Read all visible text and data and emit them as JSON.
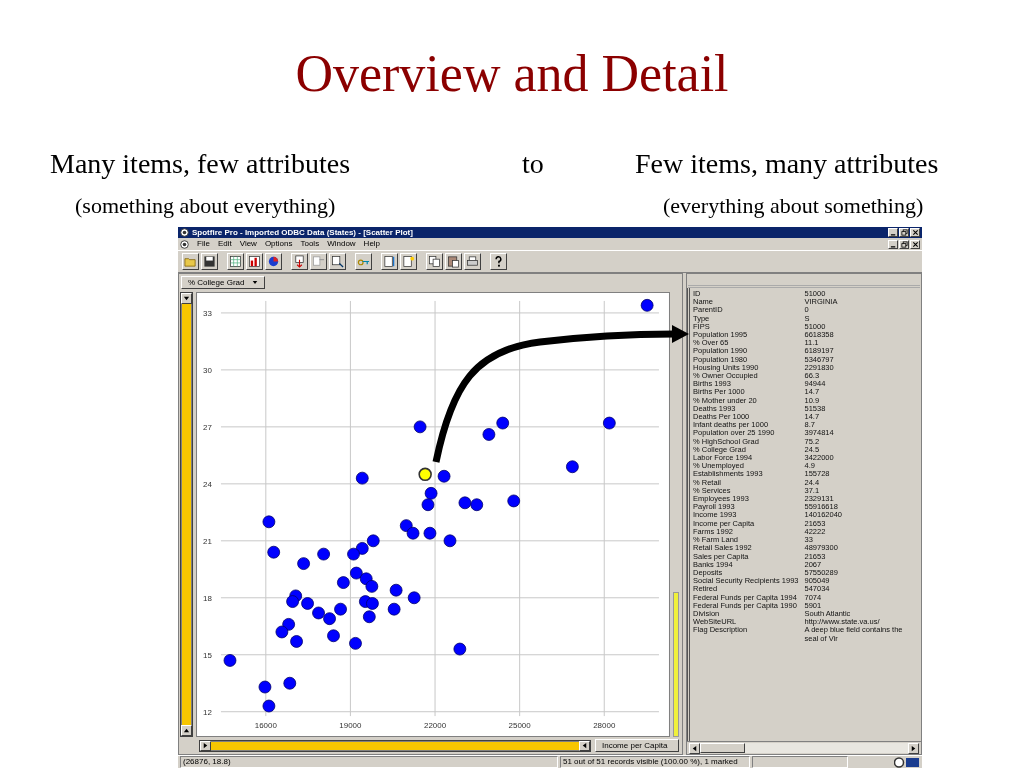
{
  "slide": {
    "title": "Overview and Detail",
    "left_heading": "Many items, few attributes",
    "connector": "to",
    "right_heading": "Few items, many attributes",
    "left_note": "(something about everything)",
    "right_note": "(everything about something)"
  },
  "window": {
    "title": "Spotfire Pro - Imported ODBC Data (States) - [Scatter Plot]"
  },
  "menu": [
    "File",
    "Edit",
    "View",
    "Options",
    "Tools",
    "Window",
    "Help"
  ],
  "scatter": {
    "y_axis_selector": "% College Grad",
    "x_axis_selector": "Income per Capita",
    "chart_data": {
      "type": "scatter",
      "grid": true,
      "xlim": [
        14410,
        29940
      ],
      "ylim": [
        11.77,
        33.63
      ],
      "xticks": [
        16000,
        19000,
        22000,
        25000,
        28000
      ],
      "yticks": [
        12,
        15,
        18,
        21,
        24,
        27,
        30,
        33
      ],
      "x": [
        29520,
        28180,
        26870,
        24400,
        23910,
        21470,
        21650,
        22320,
        19420,
        21860,
        21750,
        23060,
        23480,
        24790,
        16110,
        20980,
        21220,
        21820,
        22530,
        19810,
        19420,
        19110,
        16280,
        18050,
        17340,
        19210,
        18750,
        19560,
        19760,
        20620,
        21260,
        17060,
        16950,
        17480,
        19530,
        19780,
        18650,
        20550,
        17870,
        18260,
        19670,
        16810,
        16570,
        17090,
        18400,
        19180,
        22880,
        14730,
        16850,
        15970,
        16110
      ],
      "series": [
        {
          "color": "#0000ff",
          "values": [
            33.4,
            27.2,
            24.9,
            27.2,
            26.6,
            27.0,
            null,
            24.4,
            24.3,
            23.5,
            22.9,
            23.0,
            22.9,
            23.1,
            22.0,
            21.8,
            21.4,
            21.4,
            21.0,
            21.0,
            20.6,
            20.3,
            20.4,
            20.3,
            19.8,
            19.3,
            18.8,
            19.0,
            18.6,
            18.4,
            18.0,
            18.1,
            17.8,
            17.7,
            17.8,
            17.7,
            17.4,
            17.4,
            17.2,
            16.9,
            17.0,
            16.6,
            16.2,
            15.7,
            16.0,
            15.6,
            15.3,
            14.7,
            13.5,
            13.3,
            12.3
          ]
        },
        {
          "color": "#ffff00",
          "values": [
            null,
            null,
            null,
            null,
            null,
            null,
            24.5,
            null,
            null,
            null,
            null,
            null,
            null,
            null,
            null,
            null,
            null,
            null,
            null,
            null,
            null,
            null,
            null,
            null,
            null,
            null,
            null,
            null,
            null,
            null,
            null,
            null,
            null,
            null,
            null,
            null,
            null,
            null,
            null,
            null,
            null,
            null,
            null,
            null,
            null,
            null,
            null,
            null,
            null,
            null,
            null
          ]
        }
      ]
    }
  },
  "details": {
    "rows": [
      {
        "label": "ID",
        "value": "51000"
      },
      {
        "label": "Name",
        "value": "VIRGINIA"
      },
      {
        "label": "ParentID",
        "value": "0"
      },
      {
        "label": "Type",
        "value": "S"
      },
      {
        "label": "FIPS",
        "value": "51000"
      },
      {
        "label": "Population 1995",
        "value": "6618358"
      },
      {
        "label": "% Over 65",
        "value": "11.1"
      },
      {
        "label": "Population 1990",
        "value": "6189197"
      },
      {
        "label": "Population 1980",
        "value": "5346797"
      },
      {
        "label": "Housing Units 1990",
        "value": "2291830"
      },
      {
        "label": "% Owner Occupied",
        "value": "66.3"
      },
      {
        "label": "Births 1993",
        "value": "94944"
      },
      {
        "label": "Births Per 1000",
        "value": "14.7"
      },
      {
        "label": "% Mother under 20",
        "value": "10.9"
      },
      {
        "label": "Deaths 1993",
        "value": "51538"
      },
      {
        "label": "Deaths Per 1000",
        "value": "14.7"
      },
      {
        "label": "Infant deaths per 1000",
        "value": "8.7"
      },
      {
        "label": "Population over 25 1990",
        "value": "3974814"
      },
      {
        "label": "% HighSchool Grad",
        "value": "75.2"
      },
      {
        "label": "% College Grad",
        "value": "24.5"
      },
      {
        "label": "Labor Force 1994",
        "value": "3422000"
      },
      {
        "label": "% Unemployed",
        "value": "4.9"
      },
      {
        "label": "Establishments 1993",
        "value": "155728"
      },
      {
        "label": "% Retail",
        "value": "24.4"
      },
      {
        "label": "% Services",
        "value": "37.1"
      },
      {
        "label": "Employees 1993",
        "value": "2329131"
      },
      {
        "label": "Payroll 1993",
        "value": "55916618"
      },
      {
        "label": "Income 1993",
        "value": "140162040"
      },
      {
        "label": "Income per Capita",
        "value": "21653"
      },
      {
        "label": "Farms 1992",
        "value": "42222"
      },
      {
        "label": "% Farm Land",
        "value": "33"
      },
      {
        "label": "Retail Sales 1992",
        "value": "48979300"
      },
      {
        "label": "Sales per Capita",
        "value": "21653"
      },
      {
        "label": "Banks 1994",
        "value": "2067"
      },
      {
        "label": "Deposits",
        "value": "57550289"
      },
      {
        "label": "Social Security Recipients 1993",
        "value": "905049"
      },
      {
        "label": "Retired",
        "value": "547034"
      },
      {
        "label": "Federal Funds per Capita 1994",
        "value": "7074"
      },
      {
        "label": "Federal Funds per Capita 1990",
        "value": "5901"
      },
      {
        "label": "Division",
        "value": "South Atlantic"
      },
      {
        "label": "WebSiteURL",
        "value": "http://www.state.va.us/"
      },
      {
        "label": "Flag Description",
        "value": "A deep blue field contains the seal of Vir"
      }
    ]
  },
  "status_bar": {
    "position": "(26876, 18.8)",
    "records": "51 out of 51 records visible (100.00 %), 1 marked"
  }
}
